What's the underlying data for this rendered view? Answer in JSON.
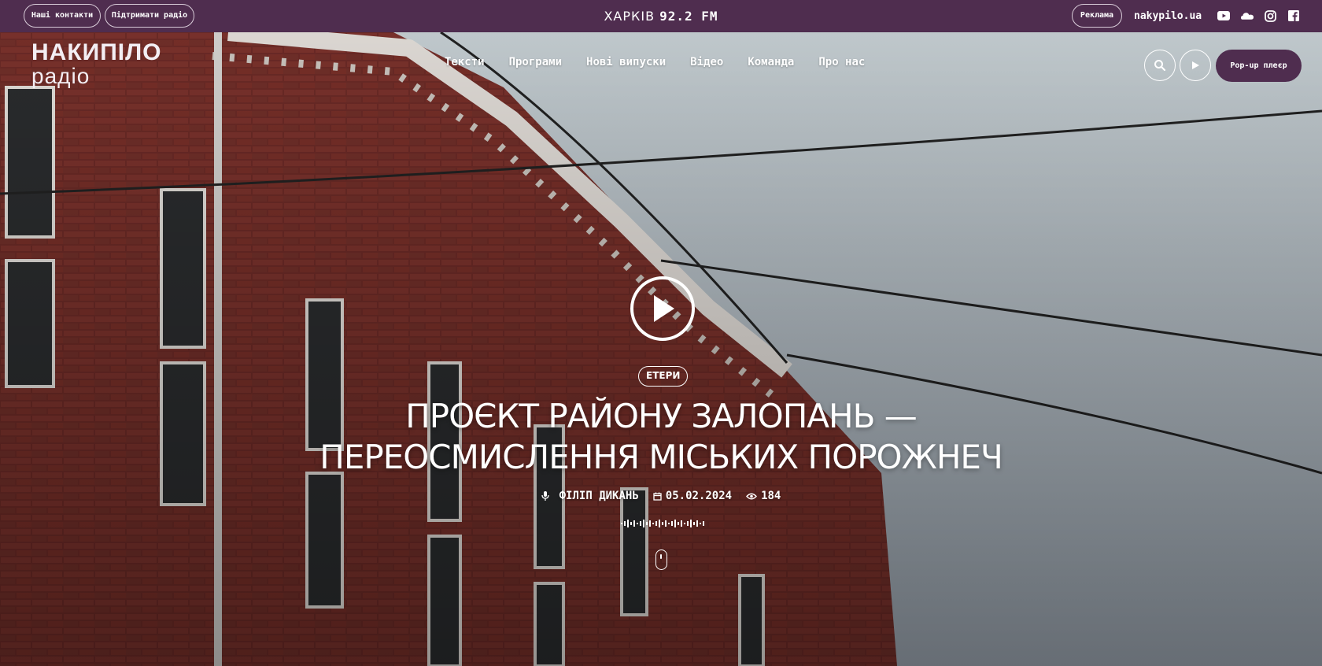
{
  "topbar": {
    "contacts_label": "Наші контакти",
    "support_label": "Підтримати радіо",
    "city": "ХАРКІВ",
    "frequency": "92.2 FM",
    "ads_label": "Реклама",
    "site": "nakypilo.ua",
    "socials": [
      "youtube-icon",
      "soundcloud-icon",
      "instagram-icon",
      "facebook-icon"
    ]
  },
  "logo": {
    "line1": "НАКИПІЛО",
    "line2": "радіо"
  },
  "nav": {
    "items": [
      "Тексти",
      "Програми",
      "Нові випуски",
      "Відео",
      "Команда",
      "Про нас"
    ]
  },
  "header_actions": {
    "popup_label": "Pop-up плеєр"
  },
  "hero": {
    "category": "ЕТЕРИ",
    "title_line1": "ПРОЄКТ РАЙОНУ ЗАЛОПАНЬ —",
    "title_line2": "ПЕРЕОСМИСЛЕННЯ МІСЬКИХ ПОРОЖНЕЧ",
    "author": "ФІЛІП ДИКАНЬ",
    "date": "05.02.2024",
    "views": "184"
  },
  "colors": {
    "brand": "#4f2d4f",
    "accent_text": "#ffffff"
  }
}
